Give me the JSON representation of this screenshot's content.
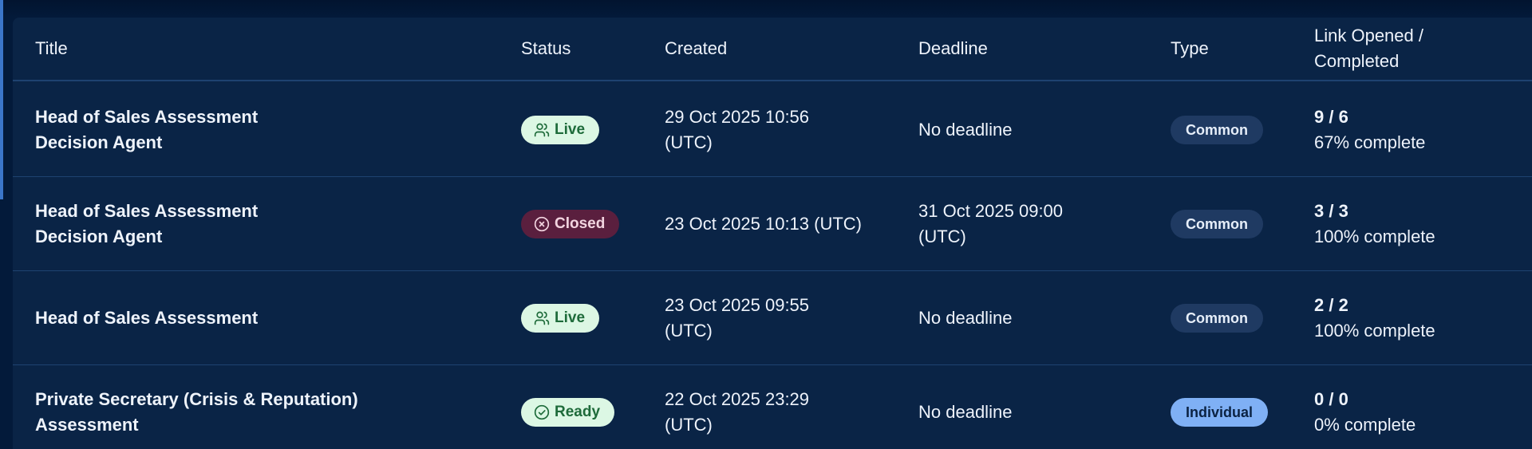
{
  "headers": {
    "title": "Title",
    "status": "Status",
    "created": "Created",
    "deadline": "Deadline",
    "type": "Type",
    "stats_line1": "Link Opened /",
    "stats_line2": "Completed"
  },
  "rows": [
    {
      "title_line1": "Head of Sales Assessment",
      "title_line2": "Decision Agent",
      "status": "Live",
      "status_icon": "users-icon",
      "created_line1": "29 Oct 2025 10:56",
      "created_line2": "(UTC)",
      "deadline_line1": "No deadline",
      "deadline_line2": "",
      "type": "Common",
      "stats": "9 / 6",
      "completion": "67% complete"
    },
    {
      "title_line1": "Head of Sales Assessment",
      "title_line2": "Decision Agent",
      "status": "Closed",
      "status_icon": "x-circle-icon",
      "created_line1": "23 Oct 2025 10:13 (UTC)",
      "created_line2": "",
      "deadline_line1": "31 Oct 2025 09:00",
      "deadline_line2": "(UTC)",
      "type": "Common",
      "stats": "3 / 3",
      "completion": "100% complete"
    },
    {
      "title_line1": "Head of Sales Assessment",
      "title_line2": "",
      "status": "Live",
      "status_icon": "users-icon",
      "created_line1": "23 Oct 2025 09:55",
      "created_line2": "(UTC)",
      "deadline_line1": "No deadline",
      "deadline_line2": "",
      "type": "Common",
      "stats": "2 / 2",
      "completion": "100% complete"
    },
    {
      "title_line1": "Private Secretary (Crisis & Reputation)",
      "title_line2": "Assessment",
      "status": "Ready",
      "status_icon": "check-circle-icon",
      "created_line1": "22 Oct 2025 23:29",
      "created_line2": "(UTC)",
      "deadline_line1": "No deadline",
      "deadline_line2": "",
      "type": "Individual",
      "stats": "0 / 0",
      "completion": "0% complete"
    }
  ],
  "colors": {
    "background": "#031a3a",
    "table": "#0a2446",
    "live_badge": "#dcf7e4",
    "closed_badge": "#5a1f3e",
    "common_pill": "#1f3a62",
    "individual_pill": "#7fb0f5"
  }
}
